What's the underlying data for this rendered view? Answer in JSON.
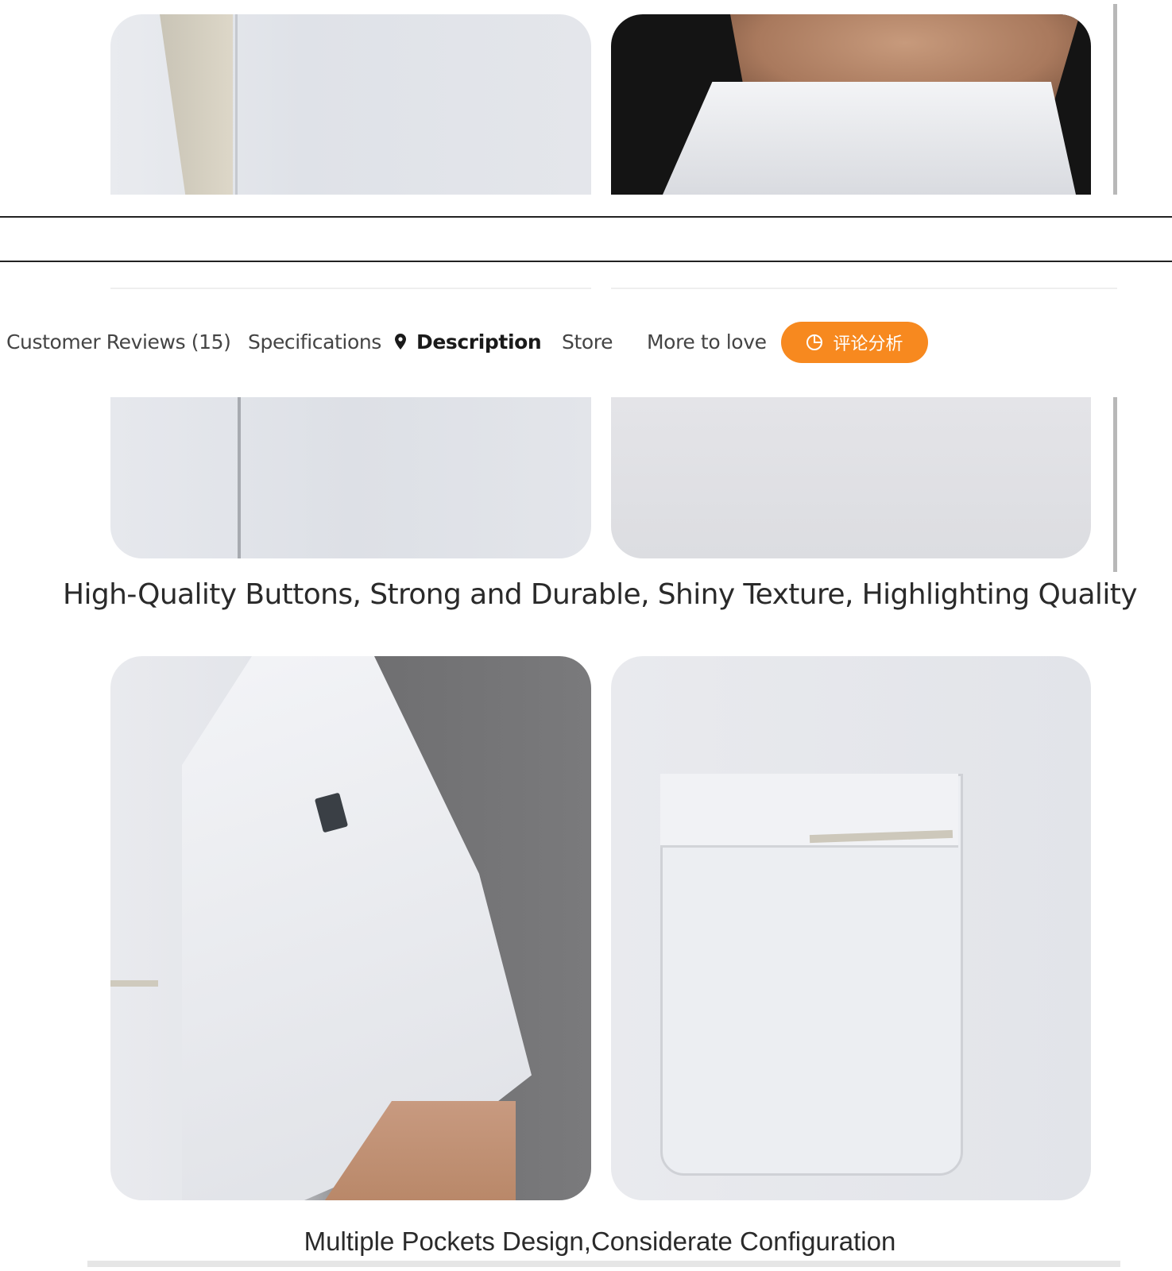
{
  "tabs": [
    {
      "label": "Customer Reviews (15)",
      "active": false
    },
    {
      "label": "Specifications",
      "active": false
    },
    {
      "label": "Description",
      "active": true
    },
    {
      "label": "Store",
      "active": false
    },
    {
      "label": "More to love",
      "active": false
    }
  ],
  "analysis_button": {
    "label": "评论分析",
    "icon": "pie-chart-icon",
    "color": "#f7891f"
  },
  "active_tab_icon": "location-pin-icon",
  "captions": {
    "buttons": "High-Quality Buttons, Strong and Durable, Shiny Texture, Highlighting Quality",
    "pockets": "Multiple Pockets Design,Considerate Configuration"
  }
}
